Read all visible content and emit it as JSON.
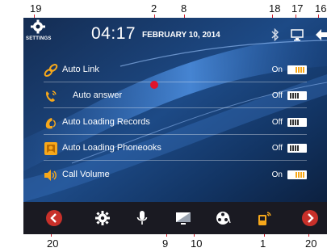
{
  "callouts": {
    "top": [
      "19",
      "2",
      "8",
      "18",
      "17",
      "16"
    ],
    "bottom": [
      "20",
      "9",
      "10",
      "1",
      "20"
    ]
  },
  "status": {
    "settings_label": "SETTINGS",
    "time": "04:17",
    "date": "FEBRUARY 10, 2014"
  },
  "rows": [
    {
      "label": "Auto  Link",
      "state": "On",
      "icon": "link-icon"
    },
    {
      "label": "Auto answer",
      "state": "Off",
      "icon": "phone-answer-icon"
    },
    {
      "label": "Auto Loading Records",
      "state": "Off",
      "icon": "phone-records-icon"
    },
    {
      "label": "Auto Loading Phoneooks",
      "state": "Off",
      "icon": "phonebook-icon"
    },
    {
      "label": "Call  Volume",
      "state": "On",
      "icon": "speaker-volume-icon"
    }
  ],
  "dock": [
    "prev-arrow-icon",
    "gear-icon",
    "microphone-icon",
    "display-icon",
    "media-icon",
    "phone-signal-icon",
    "next-arrow-icon"
  ],
  "colors": {
    "accent_orange": "#f7a81b",
    "marker_red": "#e0142a",
    "nav_red": "#c8302a",
    "background_navy": "#0d1f3d"
  }
}
